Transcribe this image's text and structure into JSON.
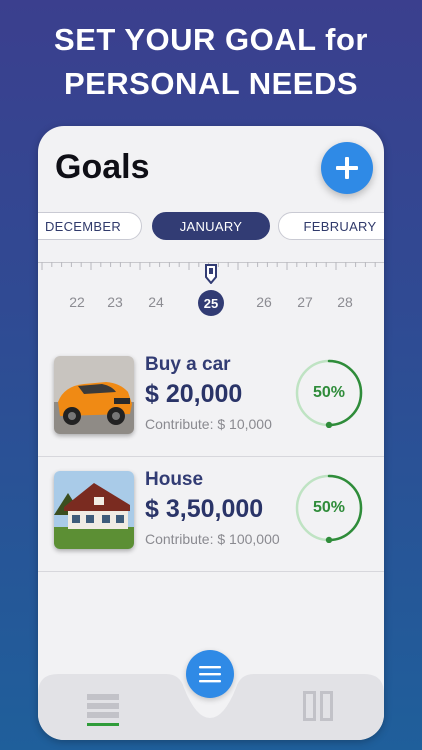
{
  "hero": {
    "line1": "SET YOUR GOAL for",
    "line2": "PERSONAL NEEDS"
  },
  "header": {
    "title": "Goals",
    "add_icon": "plus-icon"
  },
  "months": {
    "items": [
      "DECEMBER",
      "JANUARY",
      "FEBRUARY"
    ],
    "selected": "JANUARY"
  },
  "days": {
    "items": [
      "22",
      "23",
      "24",
      "25",
      "26",
      "27",
      "28"
    ],
    "selected": "25"
  },
  "goals": [
    {
      "name": "Buy a car",
      "amount": "$ 20,000",
      "contribute": "Contribute: $ 10,000",
      "percent": "50%",
      "progress": 0.5,
      "image": "orange-sports-car"
    },
    {
      "name": "House",
      "amount": "$ 3,50,000",
      "contribute": "Contribute: $ 100,000",
      "percent": "50%",
      "progress": 0.5,
      "image": "house-photo"
    }
  ],
  "tabbar": {
    "menu_icon": "menu-icon",
    "left_icon": "list-icon",
    "right_icon": "book-icon"
  },
  "colors": {
    "accent": "#2f8ae6",
    "navy": "#323c74",
    "progress": "#2f8c3a",
    "progress_track": "#bfe3c3"
  }
}
